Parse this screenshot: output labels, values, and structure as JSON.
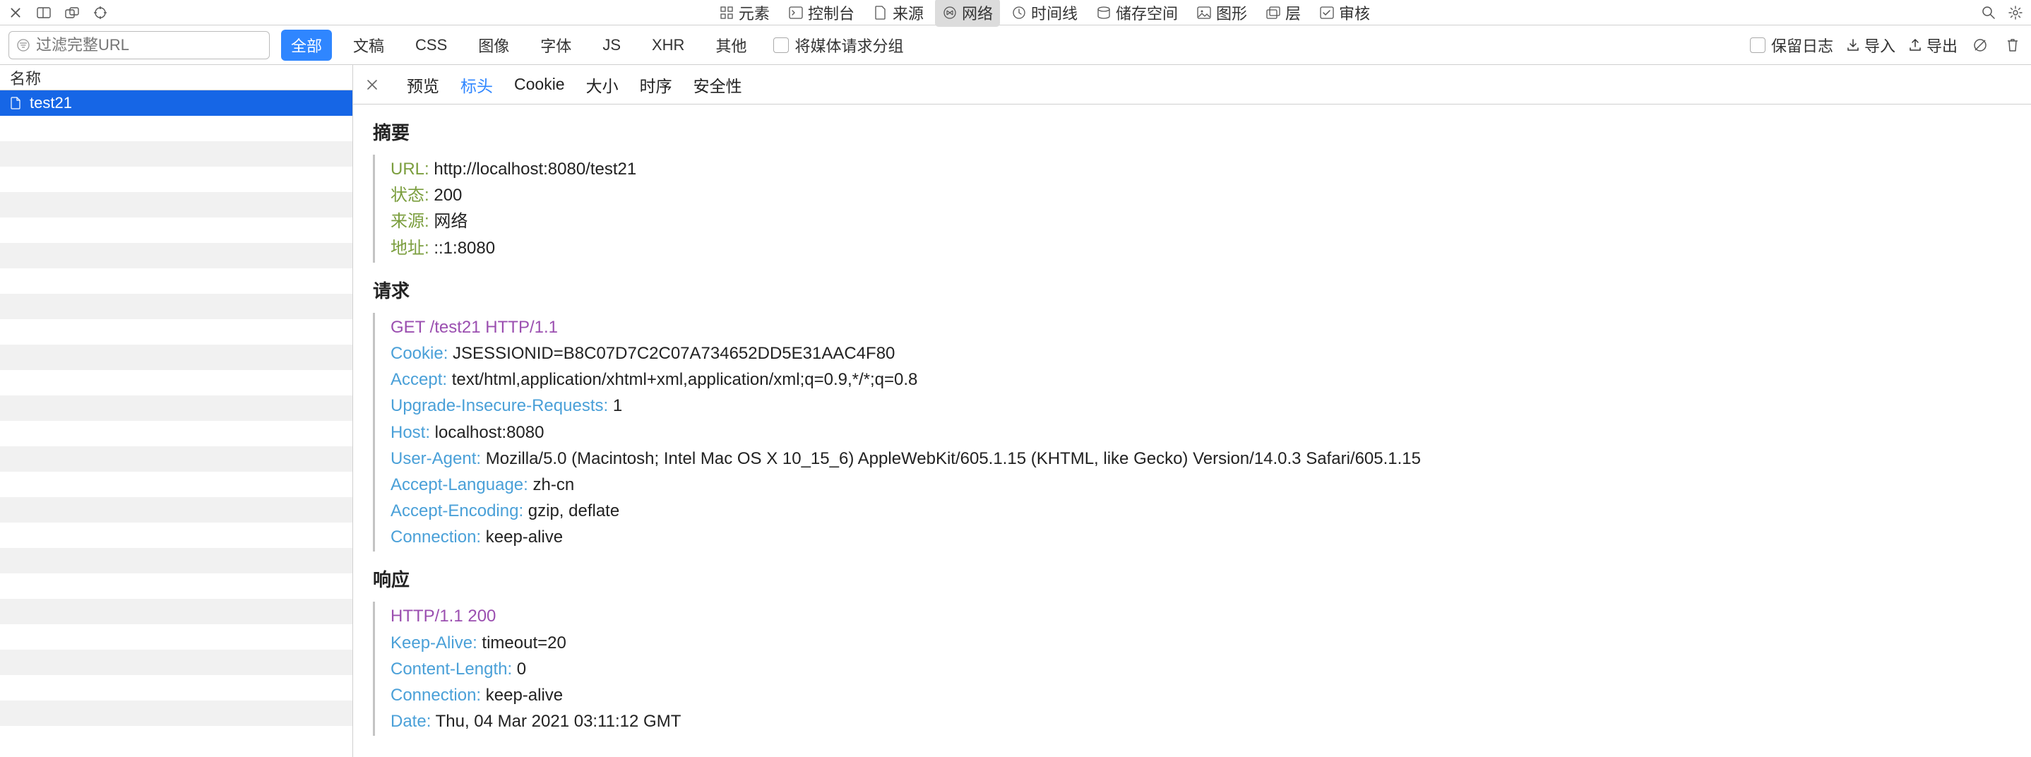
{
  "topTabs": {
    "elements": "元素",
    "console": "控制台",
    "sources": "来源",
    "network": "网络",
    "timeline": "时间线",
    "storage": "储存空间",
    "graphics": "图形",
    "layers": "层",
    "audit": "审核"
  },
  "filterBar": {
    "urlPlaceholder": "过滤完整URL",
    "filters": {
      "all": "全部",
      "doc": "文稿",
      "css": "CSS",
      "image": "图像",
      "font": "字体",
      "js": "JS",
      "xhr": "XHR",
      "other": "其他"
    },
    "groupMedia": "将媒体请求分组",
    "preserveLog": "保留日志",
    "import": "导入",
    "export": "导出"
  },
  "sidebar": {
    "header": "名称",
    "rows": [
      "test21"
    ]
  },
  "detailTabs": {
    "preview": "预览",
    "headers": "标头",
    "cookie": "Cookie",
    "size": "大小",
    "timing": "时序",
    "security": "安全性"
  },
  "sections": {
    "summary": {
      "title": "摘要",
      "items": [
        {
          "k": "URL:",
          "v": "http://localhost:8080/test21"
        },
        {
          "k": "状态:",
          "v": "200"
        },
        {
          "k": "来源:",
          "v": "网络"
        },
        {
          "k": "地址:",
          "v": "::1:8080"
        }
      ]
    },
    "request": {
      "title": "请求",
      "firstLine": "GET /test21 HTTP/1.1",
      "items": [
        {
          "k": "Cookie:",
          "v": "JSESSIONID=B8C07D7C2C07A734652DD5E31AAC4F80"
        },
        {
          "k": "Accept:",
          "v": "text/html,application/xhtml+xml,application/xml;q=0.9,*/*;q=0.8"
        },
        {
          "k": "Upgrade-Insecure-Requests:",
          "v": "1"
        },
        {
          "k": "Host:",
          "v": "localhost:8080"
        },
        {
          "k": "User-Agent:",
          "v": "Mozilla/5.0 (Macintosh; Intel Mac OS X 10_15_6) AppleWebKit/605.1.15 (KHTML, like Gecko) Version/14.0.3 Safari/605.1.15"
        },
        {
          "k": "Accept-Language:",
          "v": "zh-cn"
        },
        {
          "k": "Accept-Encoding:",
          "v": "gzip, deflate"
        },
        {
          "k": "Connection:",
          "v": "keep-alive"
        }
      ]
    },
    "response": {
      "title": "响应",
      "firstLine": "HTTP/1.1 200",
      "items": [
        {
          "k": "Keep-Alive:",
          "v": "timeout=20"
        },
        {
          "k": "Content-Length:",
          "v": "0"
        },
        {
          "k": "Connection:",
          "v": "keep-alive"
        },
        {
          "k": "Date:",
          "v": "Thu, 04 Mar 2021 03:11:12 GMT"
        }
      ]
    }
  }
}
